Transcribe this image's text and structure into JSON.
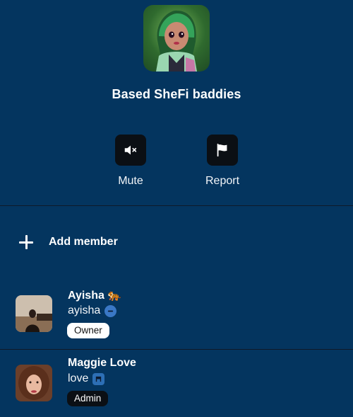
{
  "group": {
    "title": "Based SheFi baddies"
  },
  "actions": {
    "mute_label": "Mute",
    "report_label": "Report"
  },
  "add_member": {
    "label": "Add member"
  },
  "members": [
    {
      "name": "Ayisha",
      "name_emoji": "🐅",
      "handle": "ayisha",
      "role": "Owner"
    },
    {
      "name": "Maggie Love",
      "handle": "love",
      "role": "Admin"
    }
  ],
  "colors": {
    "background": "#04355f",
    "button_dark": "#0b0f14",
    "divider": "#0f1a28",
    "badge_blue": "#2d6fb5"
  },
  "icons": {
    "mute": "speaker-muted-icon",
    "report": "flag-icon",
    "add": "plus-icon"
  }
}
